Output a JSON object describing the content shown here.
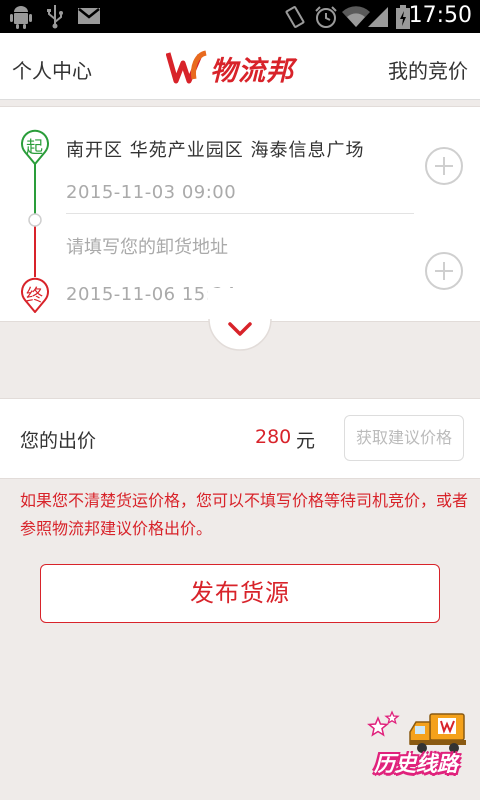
{
  "statusbar": {
    "time": "17:50"
  },
  "header": {
    "left_link": "个人中心",
    "logo_text": "物流邦",
    "right_link": "我的竞价"
  },
  "route": {
    "start_badge": "起",
    "end_badge": "终",
    "origin_address": "南开区  华苑产业园区  海泰信息广场",
    "origin_time": "2015-11-03  09:00",
    "destination_placeholder": "请填写您的卸货地址",
    "destination_time": "2015-11-06  15:24"
  },
  "price": {
    "label": "您的出价",
    "value": "280",
    "unit": "元",
    "suggest_button": "获取建议价格"
  },
  "note": "如果您不清楚货运价格，您可以不填写价格等待司机竞价，或者参照物流邦建议价格出价。",
  "publish_button": "发布货源",
  "history_button": "历史线路",
  "colors": {
    "accent_red": "#d8232a",
    "start_green": "#2a9d3a",
    "background": "#efebe9"
  }
}
